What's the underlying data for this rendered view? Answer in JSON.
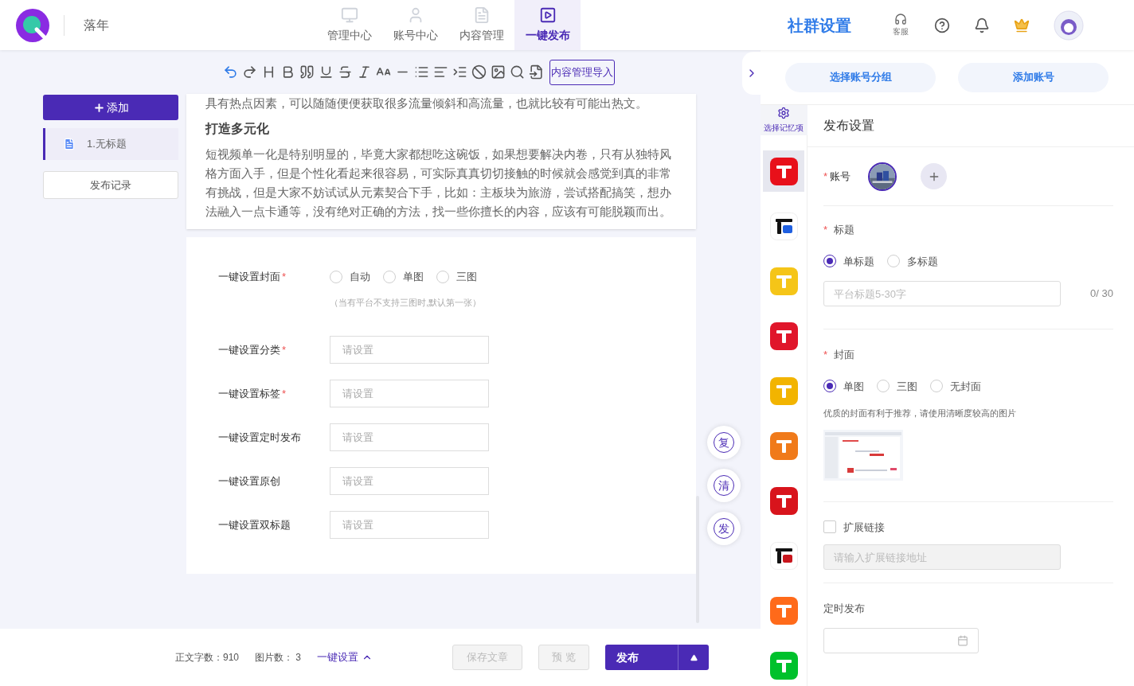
{
  "header": {
    "brand": "落年",
    "nav": [
      {
        "label": "管理中心",
        "kind": "monitor",
        "selected": false
      },
      {
        "label": "账号中心",
        "kind": "user",
        "selected": false
      },
      {
        "label": "内容管理",
        "kind": "doc",
        "selected": false
      },
      {
        "label": "一键发布",
        "kind": "play",
        "selected": true
      }
    ],
    "page_title": "社群设置",
    "support": "客服"
  },
  "toolbar": {
    "import_button": "内容管理导入"
  },
  "sidebar": {
    "add_button": "添加",
    "documents": [
      {
        "label": "1.无标题",
        "selected": true
      }
    ],
    "history_button": "发布记录"
  },
  "article": {
    "paragraphs": [
      {
        "kind": "text",
        "text": "具有热点因素，可以随随便便获取很多流量倾斜和高流量，也就比较有可能出热文。"
      },
      {
        "kind": "heading",
        "text": "打造多元化"
      },
      {
        "kind": "text",
        "text": "短视频单一化是特别明显的，毕竟大家都想吃这碗饭，如果想要解决内卷，只有从独特风格方面入手，但是个性化看起来很容易，可实际真真切切接触的时候就会感觉到真的非常有挑战，但是大家不妨试试从元素契合下手，比如：主板块为旅游，尝试搭配搞笑，想办法融入一点卡通等，没有绝对正确的方法，找一些你擅长的内容，应该有可能脱颖而出。"
      }
    ]
  },
  "quick_settings": [
    {
      "kind": "radio",
      "label": "一键设置封面",
      "required_mark": "*",
      "options": [
        {
          "label": "自动",
          "selected": false
        },
        {
          "label": "单图",
          "selected": false
        },
        {
          "label": "三图",
          "selected": false
        }
      ],
      "note": "（当有平台不支持三图时,默认第一张）"
    },
    {
      "kind": "field",
      "label": "一键设置分类",
      "required_mark": "*",
      "placeholder": "请设置"
    },
    {
      "kind": "field",
      "label": "一键设置标签",
      "required_mark": "*",
      "placeholder": "请设置"
    },
    {
      "kind": "field",
      "label": "一键设置定时发布",
      "placeholder": "请设置"
    },
    {
      "kind": "field",
      "label": "一键设置原创",
      "placeholder": "请设置"
    },
    {
      "kind": "field",
      "label": "一键设置双标题",
      "placeholder": "请设置"
    }
  ],
  "float_buttons": [
    "复",
    "清",
    "发"
  ],
  "footer": {
    "word_count": "正文字数：910",
    "image_count": "图片数： 3",
    "quick_setup": "一键设置",
    "save_button": {
      "label": "保存文章",
      "disabled": true
    },
    "preview_button": {
      "label": "预 览",
      "disabled": true
    },
    "publish_button": "发布"
  },
  "right_panel": {
    "group_button": "选择账号分组",
    "add_account_button": "添加账号",
    "memory_button": "选择记忆项",
    "platforms": [
      {
        "kind": "solid",
        "color": "#e8101a",
        "selected": true
      },
      {
        "kind": "light",
        "color": "#1f5fe0",
        "selected": false
      },
      {
        "kind": "solid",
        "color": "#f5c518",
        "selected": false
      },
      {
        "kind": "solid",
        "color": "#e0162b",
        "selected": false
      },
      {
        "kind": "solid",
        "color": "#f2b400",
        "selected": false
      },
      {
        "kind": "solid",
        "color": "#f07a1a",
        "selected": false
      },
      {
        "kind": "solid",
        "color": "#d8141c",
        "selected": false
      },
      {
        "kind": "light",
        "color": "#c8161d",
        "selected": false
      },
      {
        "kind": "solid",
        "color": "#ff6a1a",
        "selected": false
      },
      {
        "kind": "solid",
        "color": "#00c12c",
        "selected": false
      }
    ],
    "heading": "发布设置",
    "account_mark": "*",
    "account_label": "账号",
    "title_mark": "*",
    "title_label": "标题",
    "title_modes": [
      {
        "label": "单标题",
        "selected": true
      },
      {
        "label": "多标题",
        "selected": false
      }
    ],
    "title_placeholder": "平台标题5-30字",
    "title_counter": "0/ 30",
    "cover_mark": "*",
    "cover_label": "封面",
    "cover_modes": [
      {
        "label": "单图",
        "selected": true
      },
      {
        "label": "三图",
        "selected": false
      },
      {
        "label": "无封面",
        "selected": false
      }
    ],
    "cover_hint": "优质的封面有利于推荐，请使用清晰度较高的图片",
    "link": {
      "label": "扩展链接",
      "checked": false,
      "placeholder": "请输入扩展链接地址"
    },
    "schedule_label": "定时发布"
  }
}
